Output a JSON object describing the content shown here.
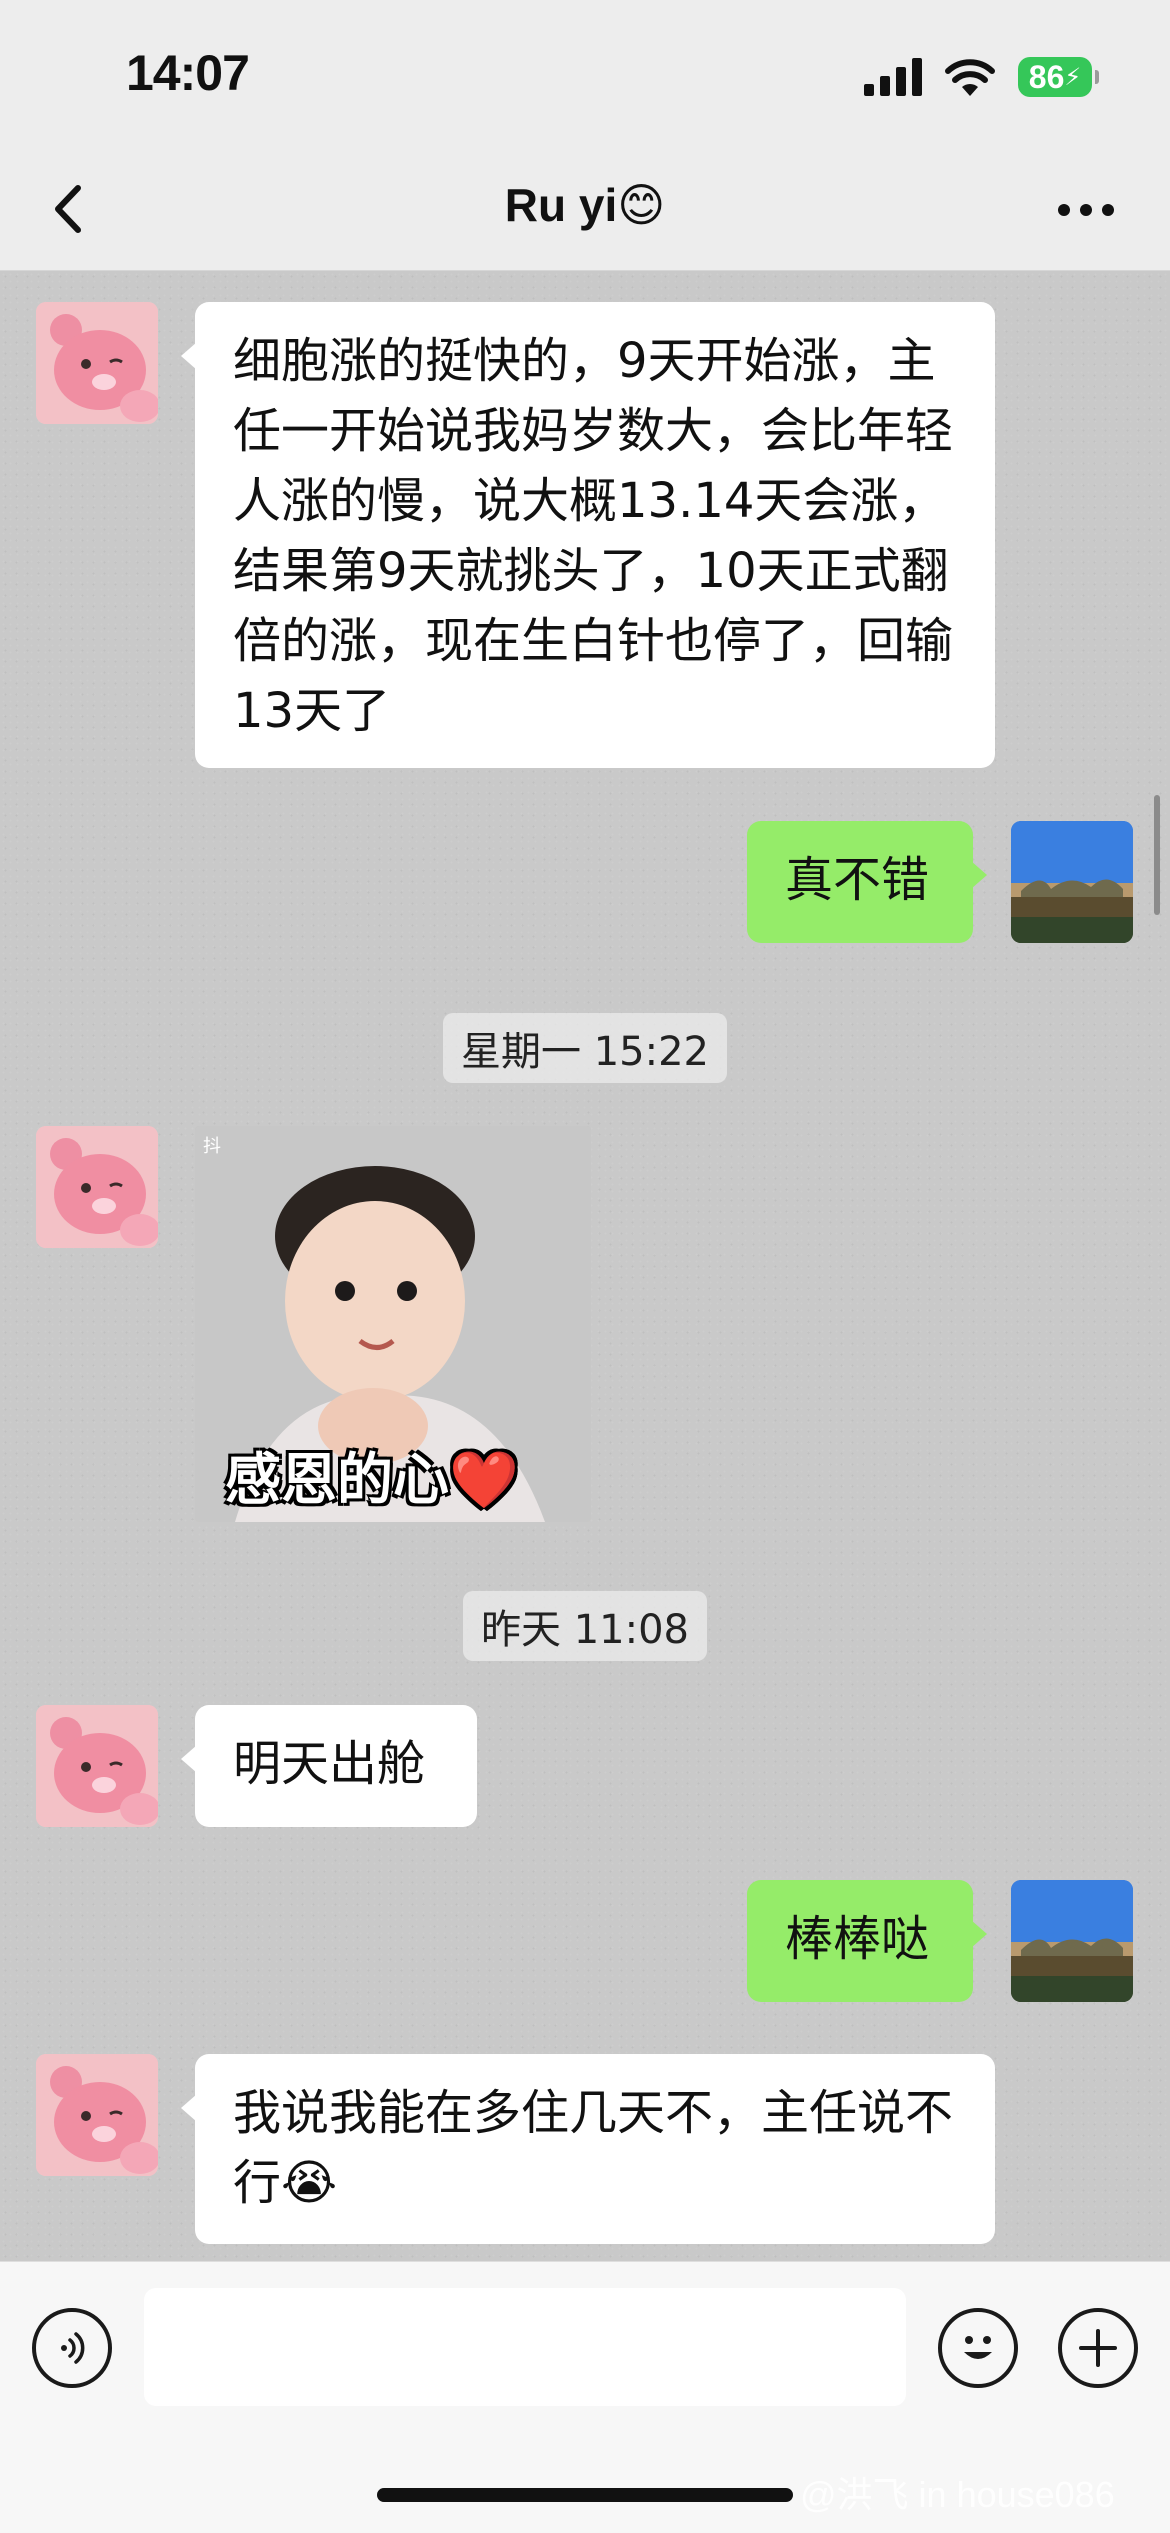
{
  "status_bar": {
    "time": "14:07",
    "battery_percent": "86"
  },
  "header": {
    "title": "Ru yi😊"
  },
  "messages": [
    {
      "side": "in",
      "text": "细胞涨的挺快的，9天开始涨，主任一开始说我妈岁数大，会比年轻人涨的慢，说大概13.14天会涨，结果第9天就挑头了，10天正式翻倍的涨，现在生白针也停了，回输13天了"
    },
    {
      "side": "out",
      "text": "真不错"
    },
    {
      "type": "timestamp",
      "text": "星期一 15:22"
    },
    {
      "side": "in",
      "type": "sticker",
      "caption": "感恩的心❤️",
      "mark": "抖"
    },
    {
      "type": "timestamp",
      "text": "昨天 11:08"
    },
    {
      "side": "in",
      "text": "明天出舱"
    },
    {
      "side": "out",
      "text": "棒棒哒"
    },
    {
      "side": "in",
      "text": "我说我能在多住几天不，主任说不行😭"
    }
  ],
  "input": {
    "value": "",
    "placeholder": ""
  },
  "watermark": "@洪飞 in house086"
}
